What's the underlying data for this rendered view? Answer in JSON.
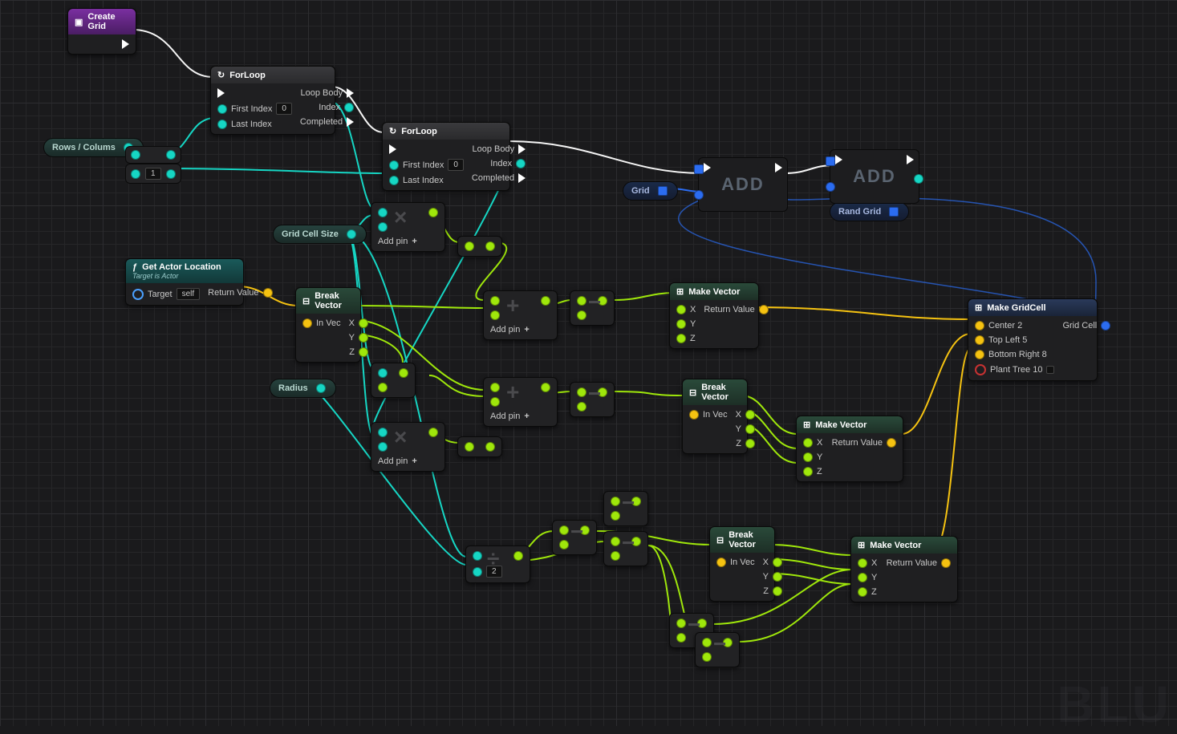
{
  "nodes": {
    "createGrid": {
      "title": "Create Grid"
    },
    "forLoop1": {
      "title": "ForLoop",
      "in": {
        "firstIndex": "First Index",
        "firstIndexVal": "0",
        "lastIndex": "Last Index"
      },
      "out": {
        "loopBody": "Loop Body",
        "index": "Index",
        "completed": "Completed"
      }
    },
    "forLoop2": {
      "title": "ForLoop",
      "in": {
        "firstIndex": "First Index",
        "firstIndexVal": "0",
        "lastIndex": "Last Index"
      },
      "out": {
        "loopBody": "Loop Body",
        "index": "Index",
        "completed": "Completed"
      }
    },
    "getActorLocation": {
      "title": "Get Actor Location",
      "subtitle": "Target is Actor",
      "in": {
        "target": "Target",
        "targetVal": "self"
      },
      "out": {
        "returnValue": "Return Value"
      }
    },
    "breakVector1": {
      "title": "Break Vector",
      "in": {
        "inVec": "In Vec"
      },
      "out": {
        "x": "X",
        "y": "Y",
        "z": "Z"
      }
    },
    "breakVector2": {
      "title": "Break Vector",
      "in": {
        "inVec": "In Vec"
      },
      "out": {
        "x": "X",
        "y": "Y",
        "z": "Z"
      }
    },
    "breakVector3": {
      "title": "Break Vector",
      "in": {
        "inVec": "In Vec"
      },
      "out": {
        "x": "X",
        "y": "Y",
        "z": "Z"
      }
    },
    "makeVector1": {
      "title": "Make Vector",
      "in": {
        "x": "X",
        "y": "Y",
        "z": "Z"
      },
      "out": {
        "returnValue": "Return Value"
      }
    },
    "makeVector2": {
      "title": "Make Vector",
      "in": {
        "x": "X",
        "y": "Y",
        "z": "Z"
      },
      "out": {
        "returnValue": "Return Value"
      }
    },
    "makeVector3": {
      "title": "Make Vector",
      "in": {
        "x": "X",
        "y": "Y",
        "z": "Z"
      },
      "out": {
        "returnValue": "Return Value"
      }
    },
    "makeGridCell": {
      "title": "Make GridCell",
      "in": {
        "center": "Center 2",
        "topLeft": "Top Left 5",
        "bottomRight": "Bottom Right 8",
        "plantTree": "Plant Tree 10"
      },
      "out": {
        "gridCell": "Grid Cell"
      }
    },
    "add1": {
      "label": "ADD"
    },
    "add2": {
      "label": "ADD"
    },
    "divide": {
      "val": "2"
    }
  },
  "pills": {
    "rowsColumns": "Rows / Colums",
    "gridCellSize": "Grid Cell Size",
    "radius": "Radius",
    "grid": "Grid",
    "randGrid": "Rand Grid"
  },
  "reroute": {
    "subtractVal": "1"
  },
  "labels": {
    "addPin": "Add pin"
  },
  "watermark": "BLU"
}
